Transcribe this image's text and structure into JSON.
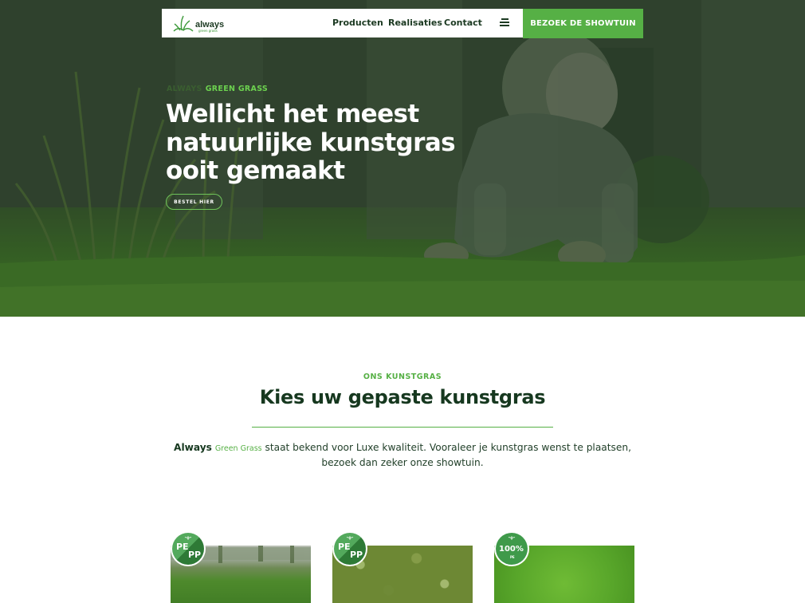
{
  "nav": {
    "logo_text": "always",
    "logo_subtext": "green grass",
    "links": [
      {
        "label": "Producten"
      },
      {
        "label": "Realisaties"
      },
      {
        "label": "Contact"
      }
    ],
    "cta_label": "BEZOEK DE SHOWTUIN"
  },
  "hero": {
    "kicker_part1": "ALWAYS",
    "kicker_part2": "GREEN GRASS",
    "title_lines": [
      "Wellicht het meest",
      "natuurlijke kunstgras",
      "ooit gemaakt"
    ],
    "button_label": "BESTEL HIER"
  },
  "section": {
    "kicker": "ONS KUNSTGRAS",
    "title": "Kies uw gepaste kunstgras",
    "text_brand1": "Always",
    "text_brand2": "Green Grass",
    "text_body": " staat bekend voor Luxe kwaliteit. Vooraleer je kunstgras wenst te plaatsen, bezoek dan zeker onze showtuin."
  },
  "products": [
    {
      "badge_top": "PE",
      "badge_bottom": "PP"
    },
    {
      "badge_top": "PE",
      "badge_bottom": "PP"
    },
    {
      "badge_top": "100%",
      "badge_bottom": "PE"
    }
  ],
  "colors": {
    "accent": "#56b045",
    "dark_green": "#16381f",
    "white": "#ffffff"
  },
  "icons": {
    "logo": "grass-sprout-logo",
    "menu": "hamburger-menu-icon",
    "badge": "sprout-icon"
  }
}
